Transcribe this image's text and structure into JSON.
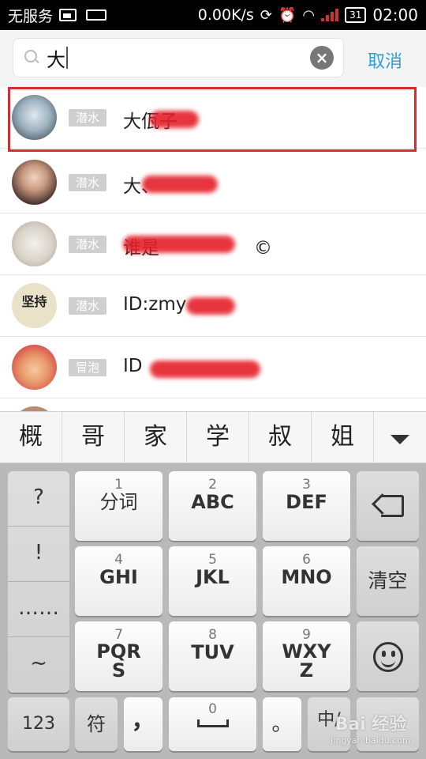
{
  "status_bar": {
    "carrier": "无服务",
    "network_speed": "0.00K/s",
    "battery": "31",
    "time": "02:00"
  },
  "search": {
    "query": "大",
    "cancel_label": "取消"
  },
  "results": [
    {
      "badge": "潜水",
      "name": "大佤子"
    },
    {
      "badge": "潜水",
      "name": "大、"
    },
    {
      "badge": "潜水",
      "name": "谁是",
      "suffix": "©"
    },
    {
      "badge": "潜水",
      "name": "ID:zmy"
    },
    {
      "badge": "冒泡",
      "name": "ID "
    }
  ],
  "candidates": [
    "概",
    "哥",
    "家",
    "学",
    "叔",
    "姐"
  ],
  "keyboard": {
    "symbols": [
      "?",
      "!",
      "……",
      "~"
    ],
    "keys": [
      {
        "num": "1",
        "label": "分词"
      },
      {
        "num": "2",
        "label": "ABC"
      },
      {
        "num": "3",
        "label": "DEF"
      },
      {
        "num": "4",
        "label": "GHI"
      },
      {
        "num": "5",
        "label": "JKL"
      },
      {
        "num": "6",
        "label": "MNO"
      },
      {
        "num": "7",
        "label": "PQRS"
      },
      {
        "num": "8",
        "label": "TUV"
      },
      {
        "num": "9",
        "label": "WXYZ"
      }
    ],
    "clear_label": "清空",
    "bottom": {
      "num_label": "123",
      "symbol_label": "符",
      "comma": "，",
      "space_num": "0",
      "period": "。",
      "lang": "中/"
    }
  },
  "watermark": {
    "line1": "Bai 经验",
    "line2": "jingyan.baidu.com"
  }
}
